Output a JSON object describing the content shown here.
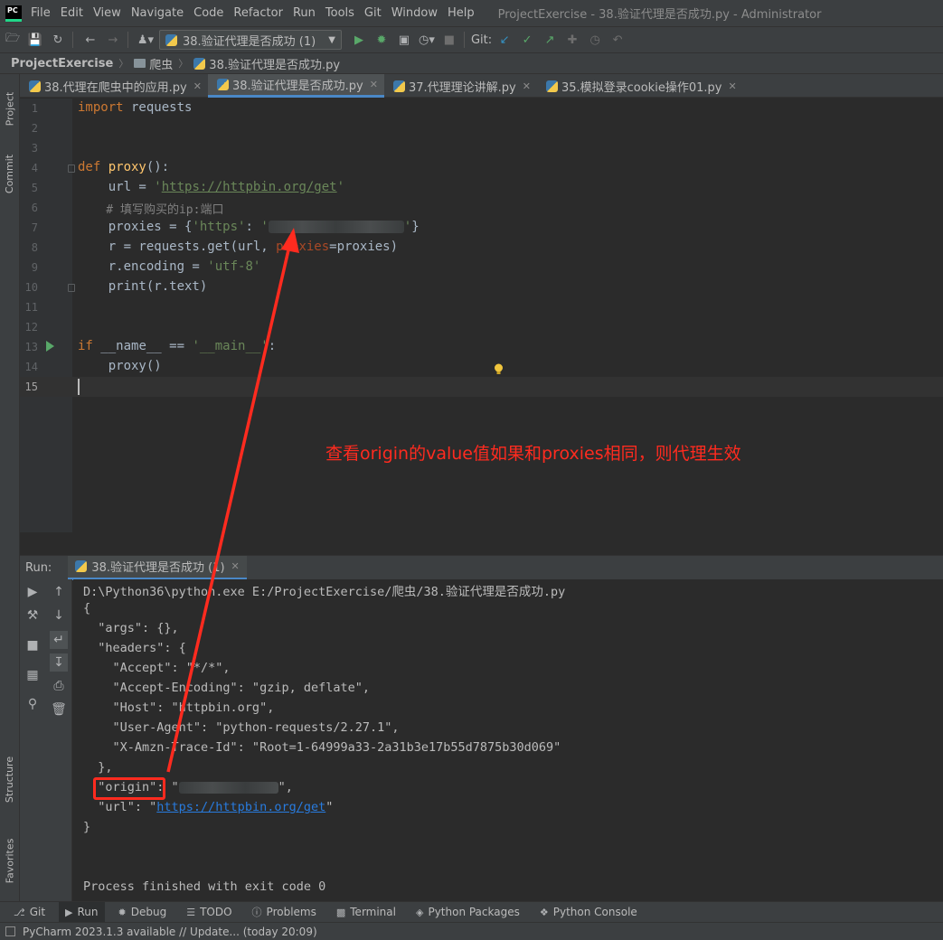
{
  "window": {
    "logo_text": "PC",
    "title": "ProjectExercise - 38.验证代理是否成功.py - Administrator",
    "menu": [
      "File",
      "Edit",
      "View",
      "Navigate",
      "Code",
      "Refactor",
      "Run",
      "Tools",
      "Git",
      "Window",
      "Help"
    ]
  },
  "toolbar": {
    "run_config": "38.验证代理是否成功 (1)",
    "git_label": "Git:"
  },
  "breadcrumb": [
    "ProjectExercise",
    "爬虫",
    "38.验证代理是否成功.py"
  ],
  "left_stripe": {
    "project": "Project",
    "commit": "Commit",
    "structure": "Structure",
    "favorites": "Favorites"
  },
  "tabs": [
    {
      "label": "38.代理在爬虫中的应用.py",
      "active": false
    },
    {
      "label": "38.验证代理是否成功.py",
      "active": true
    },
    {
      "label": "37.代理理论讲解.py",
      "active": false
    },
    {
      "label": "35.模拟登录cookie操作01.py",
      "active": false
    }
  ],
  "editor": {
    "line_numbers": [
      "1",
      "2",
      "3",
      "4",
      "5",
      "6",
      "7",
      "8",
      "9",
      "10",
      "11",
      "12",
      "13",
      "14",
      "15"
    ],
    "current_line": "15",
    "code": {
      "l1_kw": "import",
      "l1_rest": " requests",
      "l4_kw": "def ",
      "l4_fn": "proxy",
      "l4_rest": "():",
      "l5_a": "    url = ",
      "l5_q1": "'",
      "l5_url": "https://httpbin.org/get",
      "l5_q2": "'",
      "l6": "    # 填写购买的ip:端口",
      "l7_a": "    proxies = {",
      "l7_key": "'https'",
      "l7_b": ": ",
      "l7_q1": "'",
      "l7_q2": "'",
      "l7_c": "}",
      "l8_a": "    r = requests.get(url, ",
      "l8_param": "proxies",
      "l8_b": "=proxies)",
      "l9_a": "    r.encoding = ",
      "l9_str": "'utf-8'",
      "l10": "    print(r.text)",
      "l13_kw": "if ",
      "l13_a": "__name__ == ",
      "l13_str": "'__main__'",
      "l13_b": ":",
      "l14": "    proxy()"
    }
  },
  "annotation": "查看origin的value值如果和proxies相同，则代理生效",
  "run_panel": {
    "label": "Run:",
    "tab": "38.验证代理是否成功 (1)",
    "output": {
      "cmd": "D:\\Python36\\python.exe E:/ProjectExercise/爬虫/38.验证代理是否成功.py",
      "o1": "{",
      "o2": "  \"args\": {},",
      "o3": "  \"headers\": {",
      "o4": "    \"Accept\": \"*/*\",",
      "o5": "    \"Accept-Encoding\": \"gzip, deflate\",",
      "o6": "    \"Host\": \"httpbin.org\",",
      "o7": "    \"User-Agent\": \"python-requests/2.27.1\",",
      "o8": "    \"X-Amzn-Trace-Id\": \"Root=1-64999a33-2a31b3e17b55d7875b30d069\"",
      "o9": "  },",
      "o10_a": "  \"origin\": \"",
      "o10_b": "\",",
      "o11_a": "  \"url\": \"",
      "o11_link": "https://httpbin.org/get",
      "o11_b": "\"",
      "o12": "}",
      "exit": "Process finished with exit code 0"
    }
  },
  "bottom_tabs": [
    "Git",
    "Run",
    "Debug",
    "TODO",
    "Problems",
    "Terminal",
    "Python Packages",
    "Python Console"
  ],
  "status": "PyCharm 2023.1.3 available // Update... (today 20:09)"
}
